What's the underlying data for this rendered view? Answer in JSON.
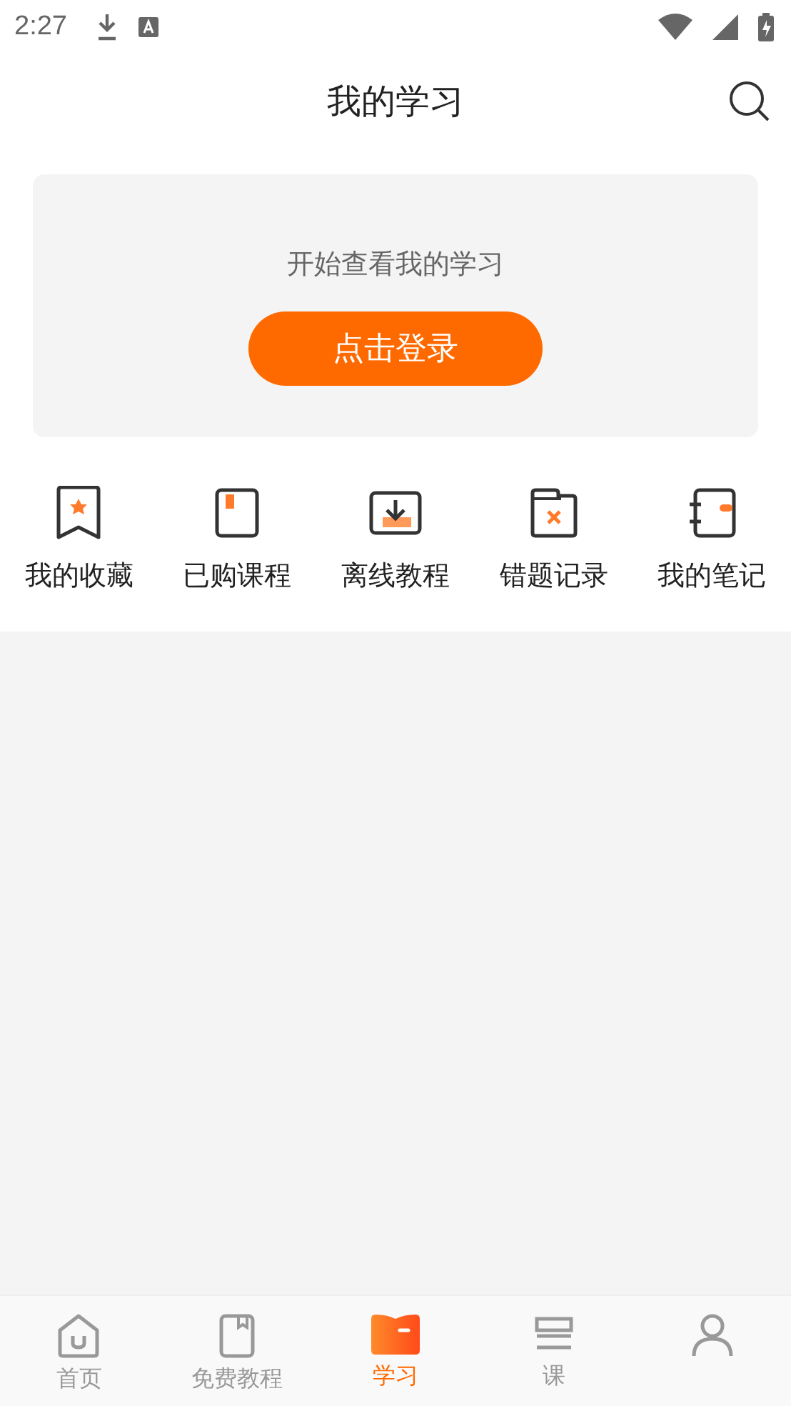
{
  "status_bar": {
    "time": "2:27"
  },
  "header": {
    "title": "我的学习"
  },
  "login_card": {
    "message": "开始查看我的学习",
    "button": "点击登录"
  },
  "shortcuts": [
    {
      "kind": "favorites",
      "label": "我的收藏"
    },
    {
      "kind": "purchased",
      "label": "已购课程"
    },
    {
      "kind": "offline",
      "label": "离线教程"
    },
    {
      "kind": "mistakes",
      "label": "错题记录"
    },
    {
      "kind": "notes",
      "label": "我的笔记"
    }
  ],
  "bottom_nav": [
    {
      "kind": "home",
      "label": "首页",
      "selected": false
    },
    {
      "kind": "free",
      "label": "免费教程",
      "selected": false
    },
    {
      "kind": "study",
      "label": "学习",
      "selected": true
    },
    {
      "kind": "courses",
      "label": "课",
      "selected": false
    },
    {
      "kind": "profile",
      "selected": false
    }
  ]
}
